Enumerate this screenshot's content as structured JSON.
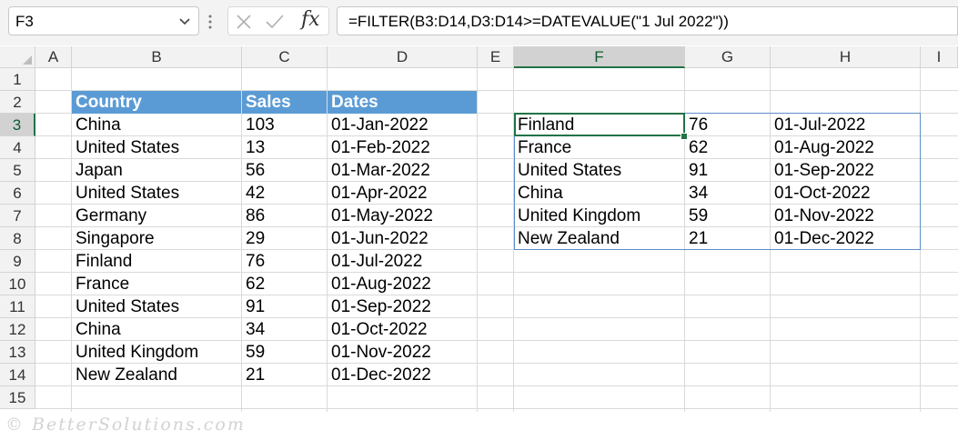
{
  "formula_bar": {
    "name_box": "F3",
    "fx_label": "fx",
    "formula": "=FILTER(B3:D14,D3:D14>=DATEVALUE(\"1 Jul 2022\"))"
  },
  "columns": [
    "A",
    "B",
    "C",
    "D",
    "E",
    "F",
    "G",
    "H",
    "I"
  ],
  "rows": [
    "1",
    "2",
    "3",
    "4",
    "5",
    "6",
    "7",
    "8",
    "9",
    "10",
    "11",
    "12",
    "13",
    "14",
    "15"
  ],
  "selected_column": "F",
  "selected_row": "3",
  "table": {
    "headers": [
      "Country",
      "Sales",
      "Dates"
    ],
    "rows": [
      [
        "China",
        "103",
        "01-Jan-2022"
      ],
      [
        "United States",
        "13",
        "01-Feb-2022"
      ],
      [
        "Japan",
        "56",
        "01-Mar-2022"
      ],
      [
        "United States",
        "42",
        "01-Apr-2022"
      ],
      [
        "Germany",
        "86",
        "01-May-2022"
      ],
      [
        "Singapore",
        "29",
        "01-Jun-2022"
      ],
      [
        "Finland",
        "76",
        "01-Jul-2022"
      ],
      [
        "France",
        "62",
        "01-Aug-2022"
      ],
      [
        "United States",
        "91",
        "01-Sep-2022"
      ],
      [
        "China",
        "34",
        "01-Oct-2022"
      ],
      [
        "United Kingdom",
        "59",
        "01-Nov-2022"
      ],
      [
        "New Zealand",
        "21",
        "01-Dec-2022"
      ]
    ]
  },
  "filter_result": {
    "rows": [
      [
        "Finland",
        "76",
        "01-Jul-2022"
      ],
      [
        "France",
        "62",
        "01-Aug-2022"
      ],
      [
        "United States",
        "91",
        "01-Sep-2022"
      ],
      [
        "China",
        "34",
        "01-Oct-2022"
      ],
      [
        "United Kingdom",
        "59",
        "01-Nov-2022"
      ],
      [
        "New Zealand",
        "21",
        "01-Dec-2022"
      ]
    ]
  },
  "watermark": "© BetterSolutions.com",
  "colors": {
    "header_fill": "#5b9bd5",
    "selection_green": "#217346",
    "spill_border": "#5f8ec7"
  },
  "icons": [
    "chevron-down-icon",
    "more-dots-icon",
    "cancel-x-icon",
    "enter-check-icon",
    "insert-function-icon"
  ]
}
